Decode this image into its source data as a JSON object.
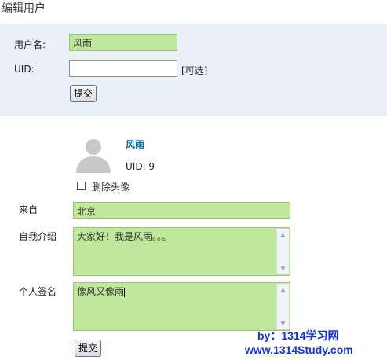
{
  "page": {
    "title": "编辑用户"
  },
  "top_form": {
    "username_label": "用户名:",
    "username_value": "风雨",
    "uid_label": "UID:",
    "uid_value": "",
    "optional_hint": "[可选]",
    "submit_label": "提交"
  },
  "profile": {
    "name": "风雨",
    "uid_text": "UID: 9",
    "delete_avatar_label": "删除头像",
    "delete_avatar_checked": false
  },
  "details_form": {
    "from_label": "来自",
    "from_value": "北京",
    "intro_label": "自我介绍",
    "intro_value": "大家好！我是风雨。。。",
    "signature_label": "个人签名",
    "signature_value": "像风又像雨",
    "submit_label": "提交"
  },
  "watermark": {
    "line1": "by：1314学习网",
    "line2": "www.1314Study.com"
  },
  "colors": {
    "panel_bg": "#e9f0f7",
    "field_highlight": "#bfe89a",
    "link": "#0a6aa1",
    "watermark": "#1536c6"
  }
}
